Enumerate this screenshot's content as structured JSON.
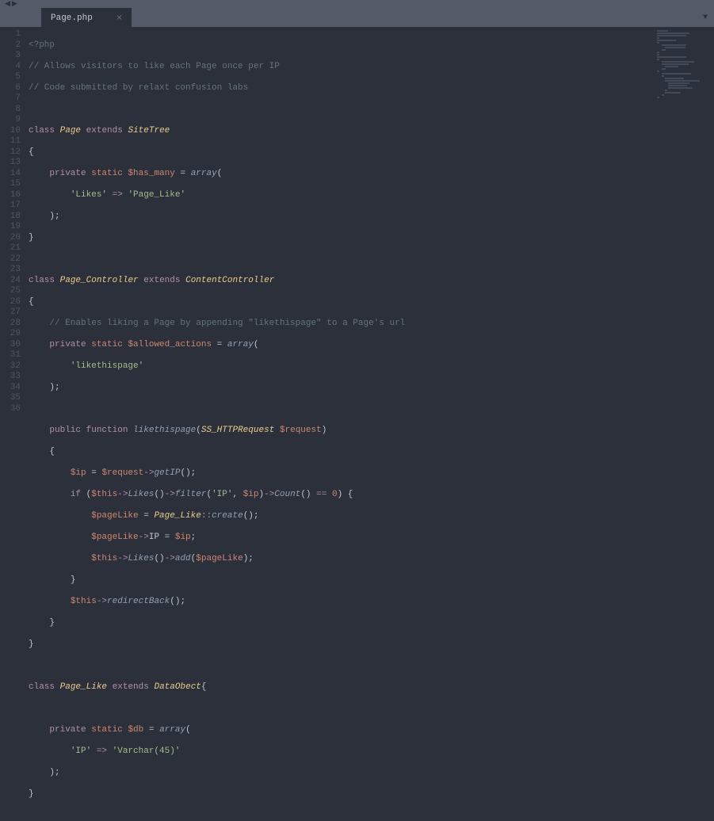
{
  "tab": {
    "filename": "Page.php",
    "close": "×"
  },
  "gutter": {
    "lines": [
      "1",
      "2",
      "3",
      "4",
      "5",
      "6",
      "7",
      "8",
      "9",
      "10",
      "11",
      "12",
      "13",
      "14",
      "15",
      "16",
      "17",
      "18",
      "19",
      "20",
      "21",
      "22",
      "23",
      "24",
      "25",
      "26",
      "27",
      "28",
      "29",
      "30",
      "31",
      "32",
      "33",
      "34",
      "35",
      "36"
    ]
  },
  "code": {
    "l1": {
      "t1": "<?php"
    },
    "l2": {
      "t1": "// Allows visitors to like each Page once per IP"
    },
    "l3": {
      "t1": "// Code submitted by relaxt confusion labs"
    },
    "l5": {
      "kw1": "class",
      "cls1": "Page",
      "kw2": "extends",
      "cls2": "SiteTree"
    },
    "l6": {
      "br": "{"
    },
    "l7": {
      "kw1": "private",
      "kw2": "static",
      "var": "$has_many",
      "eq": " = ",
      "fn": "array",
      "p": "("
    },
    "l8": {
      "s1": "'Likes'",
      "arr": " => ",
      "s2": "'Page_Like'"
    },
    "l9": {
      "p": ");"
    },
    "l10": {
      "br": "}"
    },
    "l12": {
      "kw1": "class",
      "cls1": "Page_Controller",
      "kw2": "extends",
      "cls2": "ContentController"
    },
    "l13": {
      "br": "{"
    },
    "l14": {
      "t1": "// Enables liking a Page by appending \"likethispage\" to a Page's url"
    },
    "l15": {
      "kw1": "private",
      "kw2": "static",
      "var": "$allowed_actions",
      "eq": " = ",
      "fn": "array",
      "p": "("
    },
    "l16": {
      "s1": "'likethispage'"
    },
    "l17": {
      "p": ");"
    },
    "l19": {
      "kw1": "public",
      "kw2": "function",
      "fn": "likethispage",
      "p1": "(",
      "typ": "SS_HTTPRequest",
      "var": "$request",
      "p2": ")"
    },
    "l20": {
      "br": "{"
    },
    "l21": {
      "v1": "$ip",
      "eq": " = ",
      "v2": "$request",
      "arr": "->",
      "fn": "getIP",
      "p": "();"
    },
    "l22": {
      "kw1": "if",
      "p1": " (",
      "v1": "$this",
      "arr1": "->",
      "fn1": "Likes",
      "p2": "()",
      "arr2": "->",
      "fn2": "filter",
      "p3": "(",
      "s1": "'IP'",
      "c": ", ",
      "v2": "$ip",
      "p4": ")",
      "arr3": "->",
      "fn3": "Count",
      "p5": "() ",
      "op": "==",
      "sp": " ",
      "n": "0",
      "p6": ") {"
    },
    "l23": {
      "v1": "$pageLike",
      "eq": " = ",
      "cls": "Page_Like",
      "op": "::",
      "fn": "create",
      "p": "();"
    },
    "l24": {
      "v1": "$pageLike",
      "arr": "->",
      "prop": "IP",
      "eq": " = ",
      "v2": "$ip",
      "p": ";"
    },
    "l25": {
      "v1": "$this",
      "arr1": "->",
      "fn1": "Likes",
      "p1": "()",
      "arr2": "->",
      "fn2": "add",
      "p2": "(",
      "v2": "$pageLike",
      "p3": ");"
    },
    "l26": {
      "br": "}"
    },
    "l27": {
      "v1": "$this",
      "arr": "->",
      "fn": "redirectBack",
      "p": "();"
    },
    "l28": {
      "br": "}"
    },
    "l29": {
      "br": "}"
    },
    "l31": {
      "kw1": "class",
      "cls1": "Page_Like",
      "kw2": "extends",
      "cls2": "DataObect",
      "br": "{"
    },
    "l33": {
      "kw1": "private",
      "kw2": "static",
      "var": "$db",
      "eq": " = ",
      "fn": "array",
      "p": "("
    },
    "l34": {
      "s1": "'IP'",
      "arr": " => ",
      "s2": "'Varchar(45)'"
    },
    "l35": {
      "p": ");"
    },
    "l36": {
      "br": "}"
    }
  }
}
